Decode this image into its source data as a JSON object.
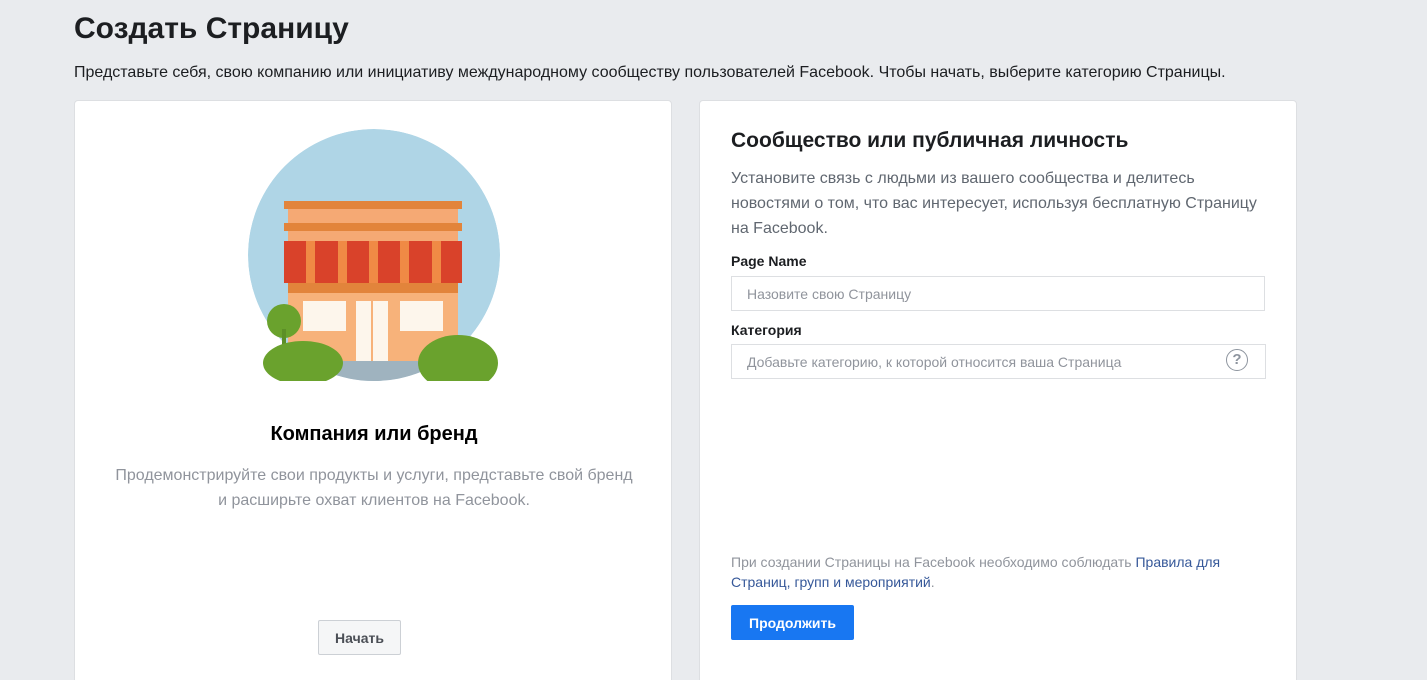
{
  "header": {
    "title": "Создать Страницу",
    "description": "Представьте себя, свою компанию или инициативу международному сообществу пользователей Facebook. Чтобы начать, выберите категорию Страницы."
  },
  "business_card": {
    "illustration": "storefront-illustration",
    "title": "Компания или бренд",
    "description": "Продемонстрируйте свои продукты и услуги, представьте свой бренд и расширьте охват клиентов на Facebook.",
    "start_label": "Начать"
  },
  "community_card": {
    "title": "Сообщество или публичная личность",
    "description": "Установите связь с людьми из вашего сообщества и делитесь новостями о том, что вас интересует, используя бесплатную Страницу на Facebook.",
    "page_name_label": "Page Name",
    "page_name_value": "",
    "page_name_placeholder": "Назовите свою Страницу",
    "category_label": "Категория",
    "category_value": "",
    "category_placeholder": "Добавьте категорию, к которой относится ваша Страница",
    "help_icon": "?",
    "policy_text": "При создании Страницы на Facebook необходимо соблюдать ",
    "policy_link": "Правила для Страниц, групп и мероприятий",
    "policy_end": ".",
    "continue_label": "Продолжить"
  },
  "colors": {
    "background": "#e9ebee",
    "primary_button": "#1877f2",
    "link": "#365899",
    "muted_text": "#90949c"
  }
}
